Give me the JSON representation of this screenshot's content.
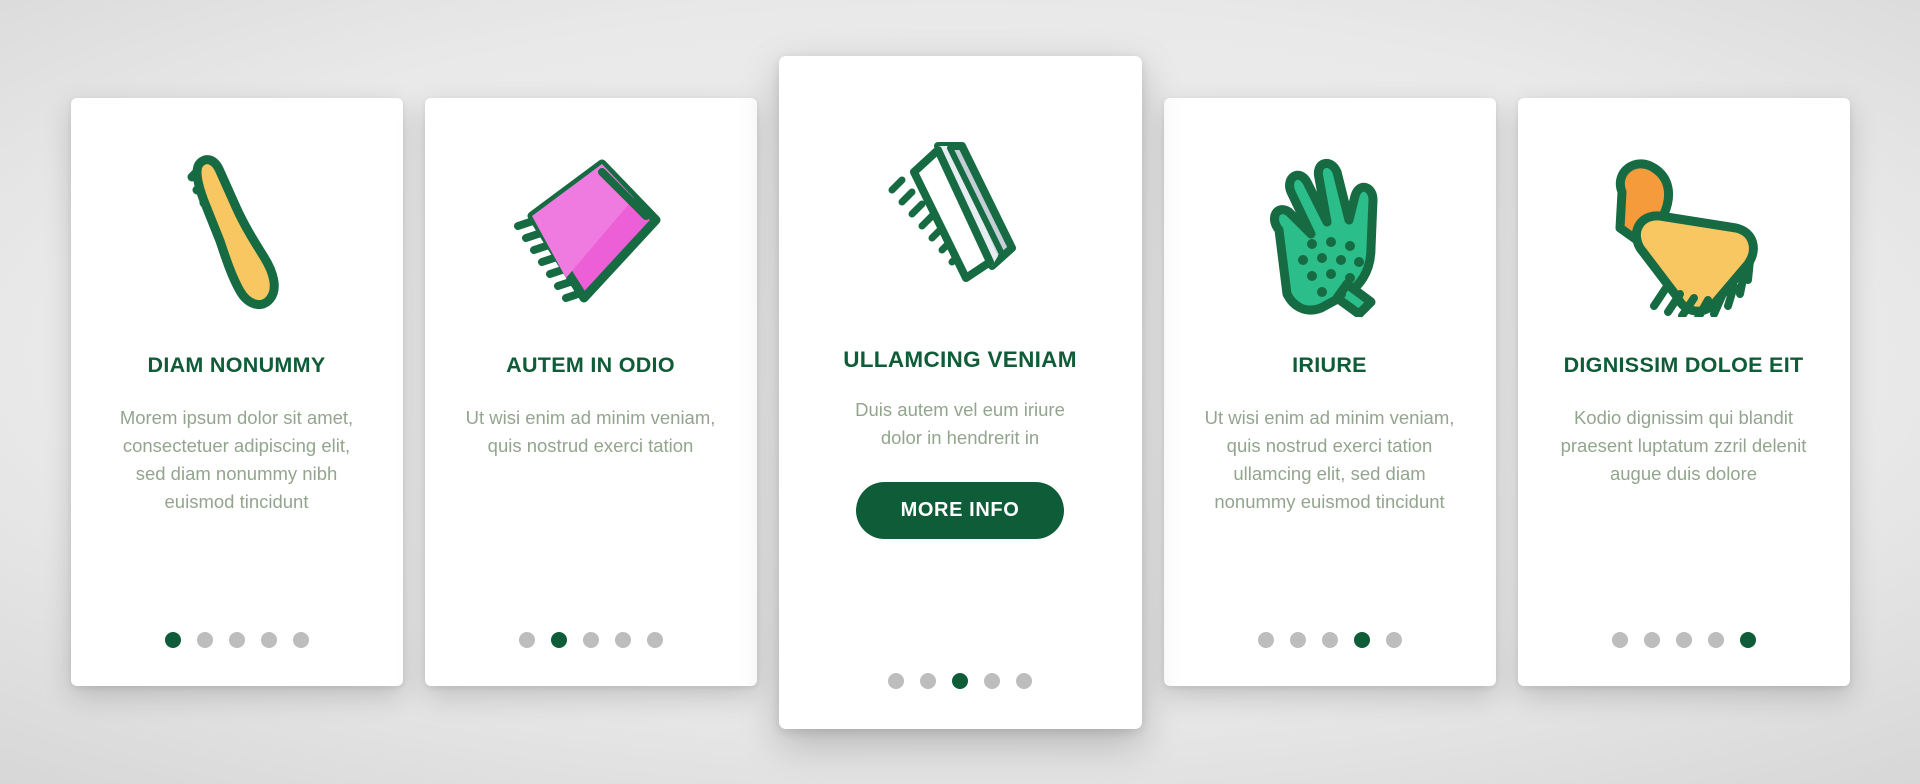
{
  "theme": {
    "accent_green": "#0f5c38",
    "icon_green_outline": "#1b6b45",
    "body_text": "#93a58e",
    "dot_inactive": "#bdbdbd",
    "card_background": "#ffffff",
    "page_background": "#d2d2d2"
  },
  "cards": [
    {
      "icon_name": "slicker-brush-icon",
      "title": "DIAM NONUMMY",
      "description": "Morem ipsum dolor sit amet, consectetuer adipiscing elit, sed diam nonummy nibh euismod tincidunt",
      "dots": {
        "count": 5,
        "active_index": 0
      },
      "has_cta": false,
      "featured": false
    },
    {
      "icon_name": "pink-comb-icon",
      "title": "AUTEM IN ODIO",
      "description": "Ut wisi enim ad minim veniam, quis nostrud exerci tation",
      "dots": {
        "count": 5,
        "active_index": 1
      },
      "has_cta": false,
      "featured": false
    },
    {
      "icon_name": "metal-comb-icon",
      "title": "ULLAMCING VENIAM",
      "description": "Duis autem vel eum iriure dolor in hendrerit in",
      "cta_label": "MORE INFO",
      "dots": {
        "count": 5,
        "active_index": 2
      },
      "has_cta": true,
      "featured": true
    },
    {
      "icon_name": "grooming-glove-icon",
      "title": "IRIURE",
      "description": "Ut wisi enim ad minim veniam, quis nostrud exerci tation ullamcing elit, sed diam nonummy euismod tincidunt",
      "dots": {
        "count": 5,
        "active_index": 3
      },
      "has_cta": false,
      "featured": false
    },
    {
      "icon_name": "rake-brush-icon",
      "title": "DIGNISSIM DOLOE EIT",
      "description": "Kodio dignissim qui blandit praesent luptatum zzril delenit augue duis dolore",
      "dots": {
        "count": 5,
        "active_index": 4
      },
      "has_cta": false,
      "featured": false
    }
  ]
}
